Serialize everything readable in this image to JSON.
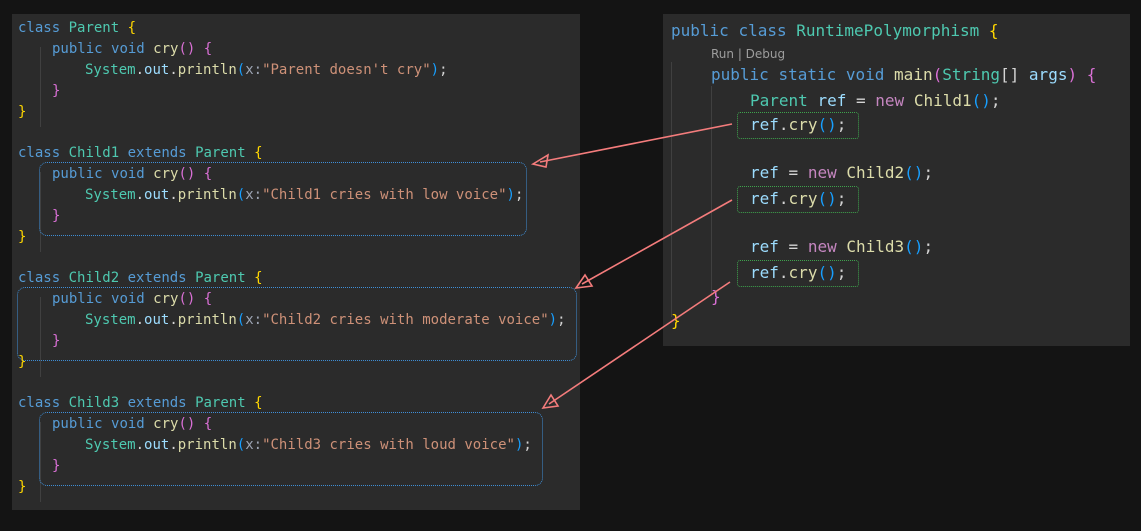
{
  "left_code": {
    "parent_header": [
      "class",
      "Parent",
      "{"
    ],
    "cry_signature": [
      "public",
      "void",
      "cry",
      "()",
      "{"
    ],
    "println": [
      "System",
      "out",
      "println"
    ],
    "param_hint": "x:",
    "parent_msg": "\"Parent doesn't cry\"",
    "child1_header": [
      "class",
      "Child1",
      "extends",
      "Parent",
      "{"
    ],
    "child1_msg": "\"Child1 cries with low voice\"",
    "child2_header": [
      "class",
      "Child2",
      "extends",
      "Parent",
      "{"
    ],
    "child2_msg": "\"Child2 cries with moderate voice\"",
    "child3_header": [
      "class",
      "Child3",
      "extends",
      "Parent",
      "{"
    ],
    "child3_msg": "\"Child3 cries with loud voice\""
  },
  "right_code": {
    "class_header": [
      "public",
      "class",
      "RuntimePolymorphism",
      "{"
    ],
    "code_lens": "Run | Debug",
    "main_signature": [
      "public",
      "static",
      "void",
      "main",
      "String",
      "args"
    ],
    "decl": [
      "Parent",
      "ref",
      "=",
      "new",
      "Child1"
    ],
    "call": [
      "ref",
      "cry"
    ],
    "assign2": [
      "ref",
      "=",
      "new",
      "Child2"
    ],
    "assign3": [
      "ref",
      "=",
      "new",
      "Child3"
    ]
  },
  "colors": {
    "arrow": "#f47c7c",
    "child_box": "#3f8fd8",
    "call_box": "#3fa34d"
  }
}
